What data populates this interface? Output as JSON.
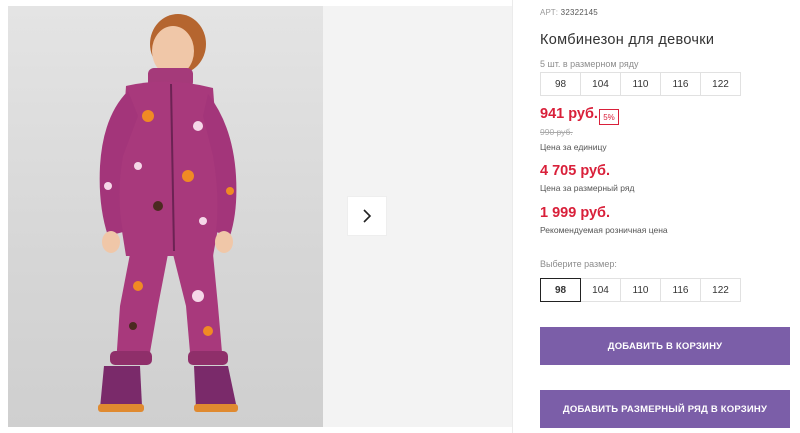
{
  "product": {
    "article_label": "АРТ:",
    "article_value": "32322145",
    "title": "Комбинезон для девочки"
  },
  "size_row": {
    "caption": "5 шт. в размерном ряду",
    "sizes": [
      "98",
      "104",
      "110",
      "116",
      "122"
    ]
  },
  "prices": {
    "unit_price": "941 руб.",
    "discount_badge": "5%",
    "old_price": "990 руб.",
    "unit_caption": "Цена за единицу",
    "row_price": "4 705 руб.",
    "row_caption": "Цена за размерный ряд",
    "retail_price": "1 999 руб.",
    "retail_caption": "Рекомендуемая розничная цена",
    "accent_color": "#d9203a"
  },
  "size_select": {
    "label": "Выберите размер:",
    "options": [
      "98",
      "104",
      "110",
      "116",
      "122"
    ],
    "selected": "98"
  },
  "actions": {
    "add_to_cart": "ДОБАВИТЬ В КОРЗИНУ",
    "add_row_to_cart": "ДОБАВИТЬ РАЗМЕРНЫЙ РЯД В КОРЗИНУ",
    "button_color": "#7b5ea8"
  },
  "gallery": {
    "next_icon": "chevron-right-icon"
  }
}
